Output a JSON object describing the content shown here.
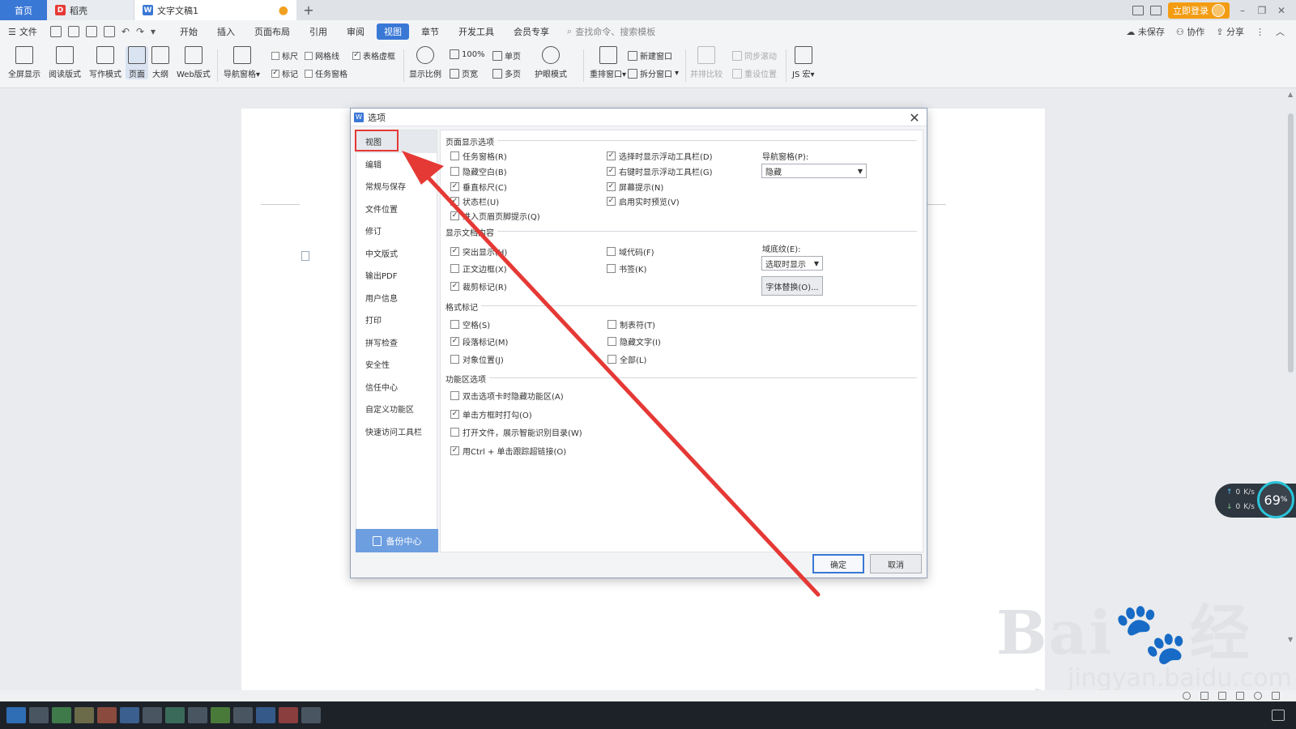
{
  "tabs": {
    "home": "首页",
    "wk": "稻壳",
    "doc": "文字文稿1",
    "add": "+"
  },
  "titlebar": {
    "login": "立即登录"
  },
  "menubar": {
    "file": "文件",
    "items": [
      "开始",
      "插入",
      "页面布局",
      "引用",
      "审阅",
      "视图",
      "章节",
      "开发工具",
      "会员专享"
    ],
    "active_index": 5,
    "search_placeholder": "查找命令、搜索模板",
    "unsaved": "未保存",
    "collab": "协作",
    "share": "分享"
  },
  "ribbon": {
    "fullscreen": "全屏显示",
    "reading": "阅读版式",
    "writing": "写作模式",
    "page": "页面",
    "outline": "大纲",
    "web": "Web版式",
    "nav_pane": "导航窗格",
    "ruler": "标尺",
    "gridlines": "网格线",
    "table_dashes": "表格虚框",
    "marks": "标记",
    "task_pane": "任务窗格",
    "display_ratio": "显示比例",
    "zoom_100": "100%",
    "single_page": "单页",
    "page_width": "页宽",
    "multi_page": "多页",
    "eye_mode": "护眼模式",
    "rearrange": "重排窗口",
    "new_window": "新建窗口",
    "split_window": "拆分窗口",
    "side_compare": "并排比较",
    "sync_scroll": "同步滚动",
    "reset_position": "重设位置",
    "js_macro": "JS 宏"
  },
  "dialog": {
    "title": "选项",
    "close": "✕",
    "sidebar": [
      "视图",
      "编辑",
      "常规与保存",
      "文件位置",
      "修订",
      "中文版式",
      "输出PDF",
      "用户信息",
      "打印",
      "拼写检查",
      "安全性",
      "信任中心",
      "自定义功能区",
      "快速访问工具栏"
    ],
    "backup": "备份中心",
    "sections": {
      "page_display": "页面显示选项",
      "show_doc": "显示文档内容",
      "format_marks": "格式标记",
      "function_area": "功能区选项"
    },
    "page_display": {
      "col1": [
        {
          "label": "任务窗格(R)",
          "checked": false
        },
        {
          "label": "隐藏空白(B)",
          "checked": false
        },
        {
          "label": "垂直标尺(C)",
          "checked": true
        },
        {
          "label": "状态栏(U)",
          "checked": true
        },
        {
          "label": "进入页眉页脚提示(Q)",
          "checked": true
        }
      ],
      "col2": [
        {
          "label": "选择时显示浮动工具栏(D)",
          "checked": true
        },
        {
          "label": "右键时显示浮动工具栏(G)",
          "checked": true
        },
        {
          "label": "屏幕提示(N)",
          "checked": true
        },
        {
          "label": "启用实时预览(V)",
          "checked": true
        }
      ],
      "nav_label": "导航窗格(P):",
      "nav_value": "隐藏"
    },
    "show_doc": {
      "col1": [
        {
          "label": "突出显示(H)",
          "checked": true
        },
        {
          "label": "正文边框(X)",
          "checked": false
        },
        {
          "label": "裁剪标记(R)",
          "checked": true
        }
      ],
      "col2": [
        {
          "label": "域代码(F)",
          "checked": false
        },
        {
          "label": "书签(K)",
          "checked": false
        }
      ],
      "field_label": "域底纹(E):",
      "field_value": "选取时显示",
      "font_replace": "字体替换(O)..."
    },
    "format_marks": {
      "col1": [
        {
          "label": "空格(S)",
          "checked": false
        },
        {
          "label": "段落标记(M)",
          "checked": true
        },
        {
          "label": "对象位置(J)",
          "checked": false
        }
      ],
      "col2": [
        {
          "label": "制表符(T)",
          "checked": false
        },
        {
          "label": "隐藏文字(I)",
          "checked": false
        },
        {
          "label": "全部(L)",
          "checked": false
        }
      ]
    },
    "function_area": {
      "items": [
        {
          "label": "双击选项卡时隐藏功能区(A)",
          "checked": false
        },
        {
          "label": "单击方框时打勾(O)",
          "checked": true
        },
        {
          "label": "打开文件，展示智能识别目录(W)",
          "checked": false
        },
        {
          "label": "用Ctrl + 单击跟踪超链接(O)",
          "checked": true
        }
      ]
    },
    "ok": "确定",
    "cancel": "取消"
  },
  "speed_widget": {
    "up": "0",
    "up_unit": "K/s",
    "down": "0",
    "down_unit": "K/s",
    "percent": "69",
    "percent_unit": "%"
  },
  "watermark": {
    "brand": "Bai",
    "brand_cn": "经验",
    "url": "jingyan.baidu.com"
  },
  "colors": {
    "accent": "#3a78d6",
    "arrow": "#e53935",
    "login": "#f39c12"
  }
}
